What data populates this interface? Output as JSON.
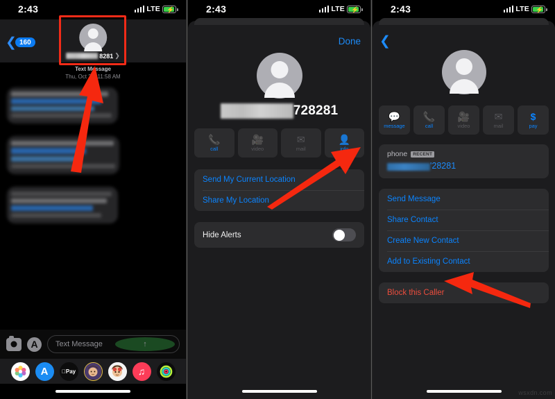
{
  "meta": {
    "watermark": "wsxdn.com"
  },
  "colors": {
    "accent_blue": "#0b84ff",
    "link_blue": "#1d8bf8",
    "danger_red": "#eb4d3d",
    "annotation_red": "#f22b18",
    "battery_green": "#3ad04a",
    "badge_blue": "#0b7bf2"
  },
  "status_bar": {
    "time": "2:43",
    "carrier_tech": "LTE",
    "signal_icon": "cellular-bars-icon",
    "battery_icon": "battery-charging-icon"
  },
  "panel1": {
    "name": "messages-conversation",
    "back_badge": "160",
    "back_icon": "chevron-left-icon",
    "contact": {
      "avatar_icon": "person-placeholder-icon",
      "number_visible": "8281",
      "detail_chevron": "chevron-right-icon"
    },
    "stamp_label": "Text Message",
    "stamp_date": "Thu, Oct 28, 11:58 AM",
    "composer": {
      "camera_icon": "camera-icon",
      "appstore_icon": "app-store-icon",
      "placeholder": "Text Message",
      "send_icon": "send-arrow-up-icon"
    },
    "dock_apps": [
      "photos-app-icon",
      "app-store-app-icon",
      "apple-pay-app-icon",
      "memoji-app-icon",
      "memoji-2-app-icon",
      "music-app-icon",
      "fitness-app-icon"
    ],
    "home_indicator": "home-indicator"
  },
  "panel2": {
    "name": "message-details-sheet",
    "done_label": "Done",
    "contact": {
      "avatar_icon": "person-placeholder-icon",
      "number_visible": "728281"
    },
    "tiles": [
      {
        "label": "call",
        "icon": "phone-icon",
        "enabled": true
      },
      {
        "label": "video",
        "icon": "video-camera-icon",
        "enabled": false
      },
      {
        "label": "mail",
        "icon": "envelope-icon",
        "enabled": false
      },
      {
        "label": "info",
        "icon": "person-circle-icon",
        "enabled": true
      }
    ],
    "location_rows": [
      "Send My Current Location",
      "Share My Location"
    ],
    "hide_alerts": {
      "label": "Hide Alerts",
      "value": "off",
      "control": "switch"
    },
    "home_indicator": "home-indicator"
  },
  "panel3": {
    "name": "contact-info-sheet",
    "back_icon": "chevron-left-icon",
    "contact": {
      "avatar_icon": "person-placeholder-icon"
    },
    "tiles": [
      {
        "label": "message",
        "icon": "message-bubble-icon",
        "enabled": true
      },
      {
        "label": "call",
        "icon": "phone-icon",
        "enabled": true
      },
      {
        "label": "video",
        "icon": "video-camera-icon",
        "enabled": false
      },
      {
        "label": "mail",
        "icon": "envelope-icon",
        "enabled": false
      },
      {
        "label": "pay",
        "icon": "dollar-sign-icon",
        "enabled": true
      }
    ],
    "phone_field": {
      "label": "phone",
      "badge": "RECENT",
      "number_visible": "'28281"
    },
    "action_rows": [
      "Send Message",
      "Share Contact",
      "Create New Contact",
      "Add to Existing Contact"
    ],
    "block_row": "Block this Caller",
    "home_indicator": "home-indicator"
  },
  "annotations": {
    "highlight_box": "header-contact-highlight",
    "arrows": [
      "arrow-to-header-contact",
      "arrow-to-info-tile",
      "arrow-to-block-caller"
    ]
  }
}
